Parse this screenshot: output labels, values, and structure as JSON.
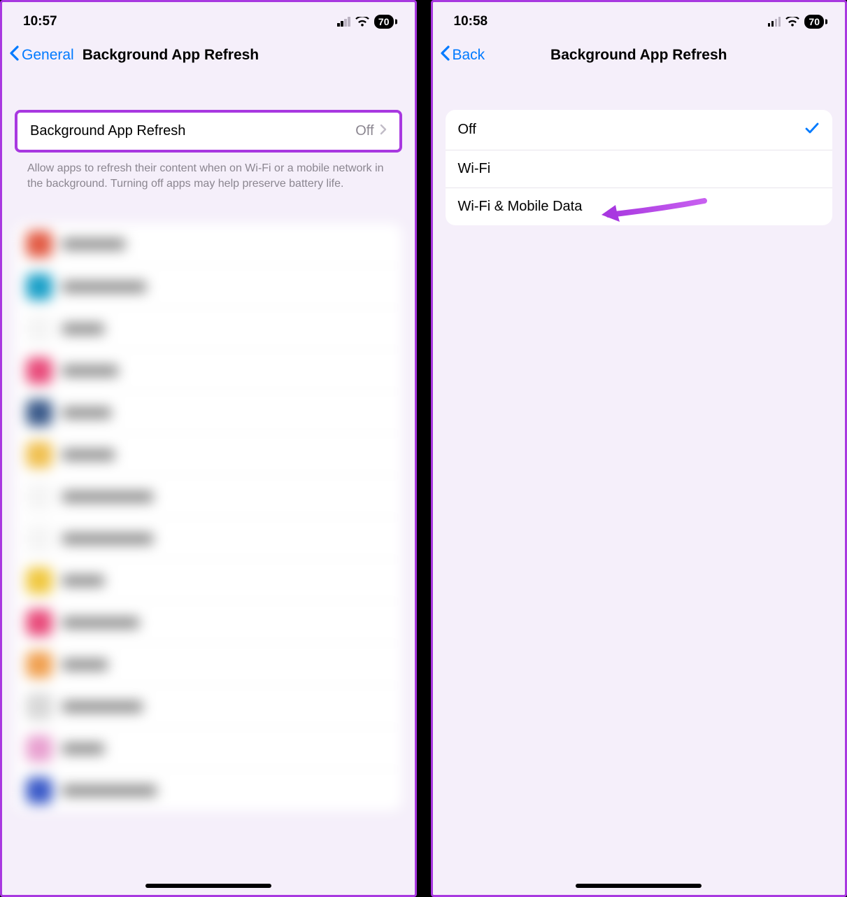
{
  "screen1": {
    "status": {
      "time": "10:57",
      "battery": "70"
    },
    "nav": {
      "back_label": "General",
      "title": "Background App Refresh"
    },
    "main_row": {
      "label": "Background App Refresh",
      "value": "Off"
    },
    "footer": "Allow apps to refresh their content when on Wi-Fi or a mobile network in the background. Turning off apps may help preserve battery life."
  },
  "screen2": {
    "status": {
      "time": "10:58",
      "battery": "70"
    },
    "nav": {
      "back_label": "Back",
      "title": "Background App Refresh"
    },
    "options": [
      {
        "label": "Off",
        "selected": true
      },
      {
        "label": "Wi-Fi",
        "selected": false
      },
      {
        "label": "Wi-Fi & Mobile Data",
        "selected": false
      }
    ]
  }
}
